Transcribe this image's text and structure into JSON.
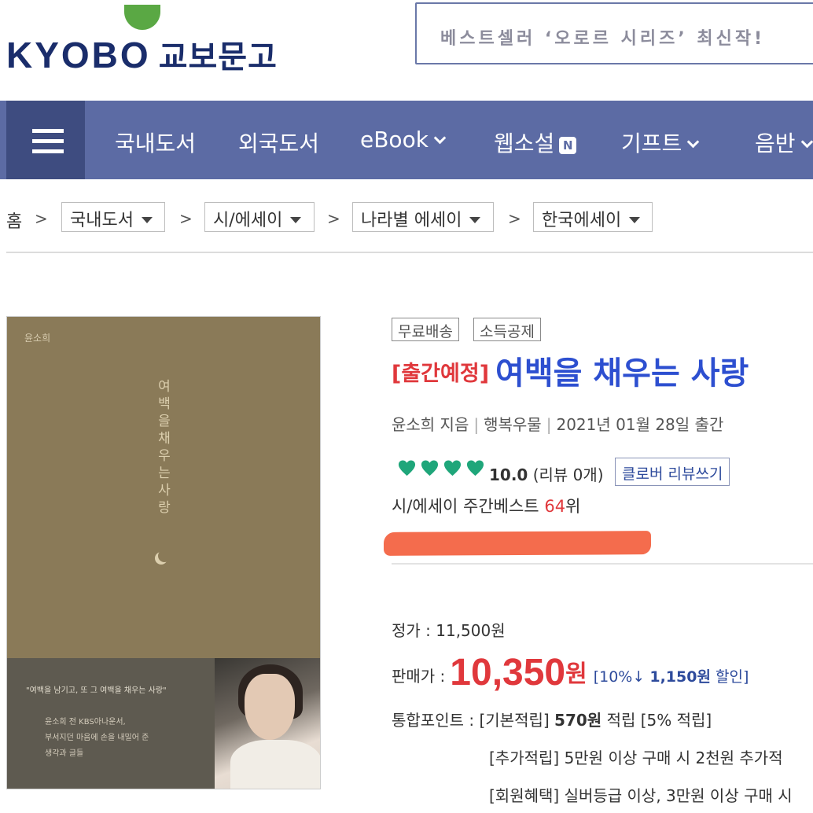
{
  "header": {
    "logo_en": "KYOBO",
    "logo_ko": "교보문고",
    "promo": "베스트셀러 ‘오로르 시리즈’ 최신작!"
  },
  "nav": {
    "items": [
      {
        "label": "국내도서",
        "has_chevron": false
      },
      {
        "label": "외국도서",
        "has_chevron": false
      },
      {
        "label": "eBook",
        "has_chevron": true
      },
      {
        "label": "웹소설",
        "badge": "N"
      },
      {
        "label": "기프트",
        "has_chevron": true
      },
      {
        "label": "음반",
        "has_chevron": true
      }
    ]
  },
  "breadcrumb": {
    "home": "홈",
    "sep": ">",
    "items": [
      "국내도서",
      "시/에세이",
      "나라별 에세이",
      "한국에세이"
    ]
  },
  "cover": {
    "author": "윤소희",
    "title_vertical": "여백을 채우는 사랑",
    "quote": "\"여백을 남기고, 또 그 여백을 채우는 사랑\"",
    "desc": "윤소희 전 KBS아나운서,\n부서지던 마음에 손을 내밀어 준\n생각과 글들"
  },
  "product": {
    "badges": [
      "무료배송",
      "소득공제"
    ],
    "status_tag": "[출간예정]",
    "title": "여백을 채우는 사랑",
    "author": "윤소희 지음",
    "publisher": "행복우물",
    "pub_date": "2021년 01월 28일 출간",
    "hearts_count": 4,
    "heart_color": "#1fa67a",
    "score": "10.0",
    "review_count": "(리뷰 0개)",
    "review_button": "클로버 리뷰쓰기",
    "rank_prefix": "시/에세이 주간베스트",
    "rank_num": "64",
    "rank_suffix": "위"
  },
  "price": {
    "list_label": "정가 : 11,500원",
    "sale_label": "판매가 :",
    "sale_value": "10,350",
    "sale_unit": "원",
    "discount_pct": "[10%↓",
    "discount_amount": "1,150원",
    "discount_suffix": "할인]"
  },
  "points": {
    "label": "통합포인트 :",
    "base_prefix": "[기본적립]",
    "base_amount": "570원",
    "base_suffix": "적립",
    "base_rate": "[5% 적립]",
    "extra": "[추가적립] 5만원 이상 구매 시 2천원 추가적",
    "member": "[회원혜택] 실버등급 이상, 3만원 이상 구매 시"
  }
}
